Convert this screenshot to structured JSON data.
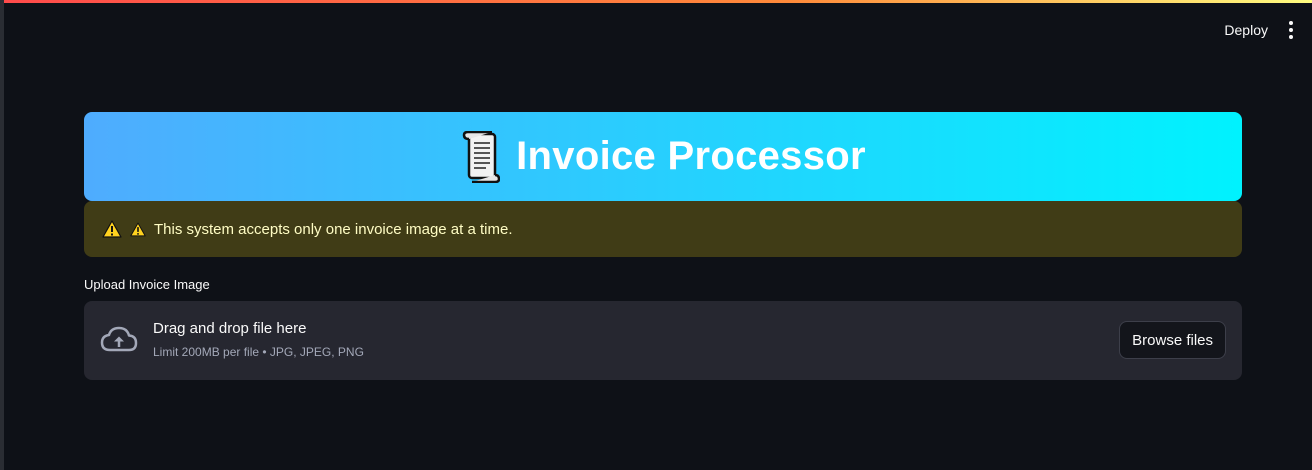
{
  "toolbar": {
    "deploy_label": "Deploy",
    "menu_icon": "more-vertical-icon"
  },
  "banner": {
    "icon": "scroll-icon",
    "title": "Invoice Processor",
    "gradient_start": "#4facfe",
    "gradient_end": "#00f2fe"
  },
  "warning": {
    "icon": "warning-icon",
    "text_icon": "⚠",
    "text": "This system accepts only one invoice image at a time.",
    "background": "#403c16"
  },
  "uploader": {
    "label": "Upload Invoice Image",
    "icon": "cloud-upload-icon",
    "title": "Drag and drop file here",
    "limit_text": "Limit 200MB per file • JPG, JPEG, PNG",
    "browse_label": "Browse files"
  },
  "colors": {
    "background": "#0e1117",
    "accent_stripe_start": "#ff4b4b",
    "accent_stripe_end": "#fffd80"
  }
}
